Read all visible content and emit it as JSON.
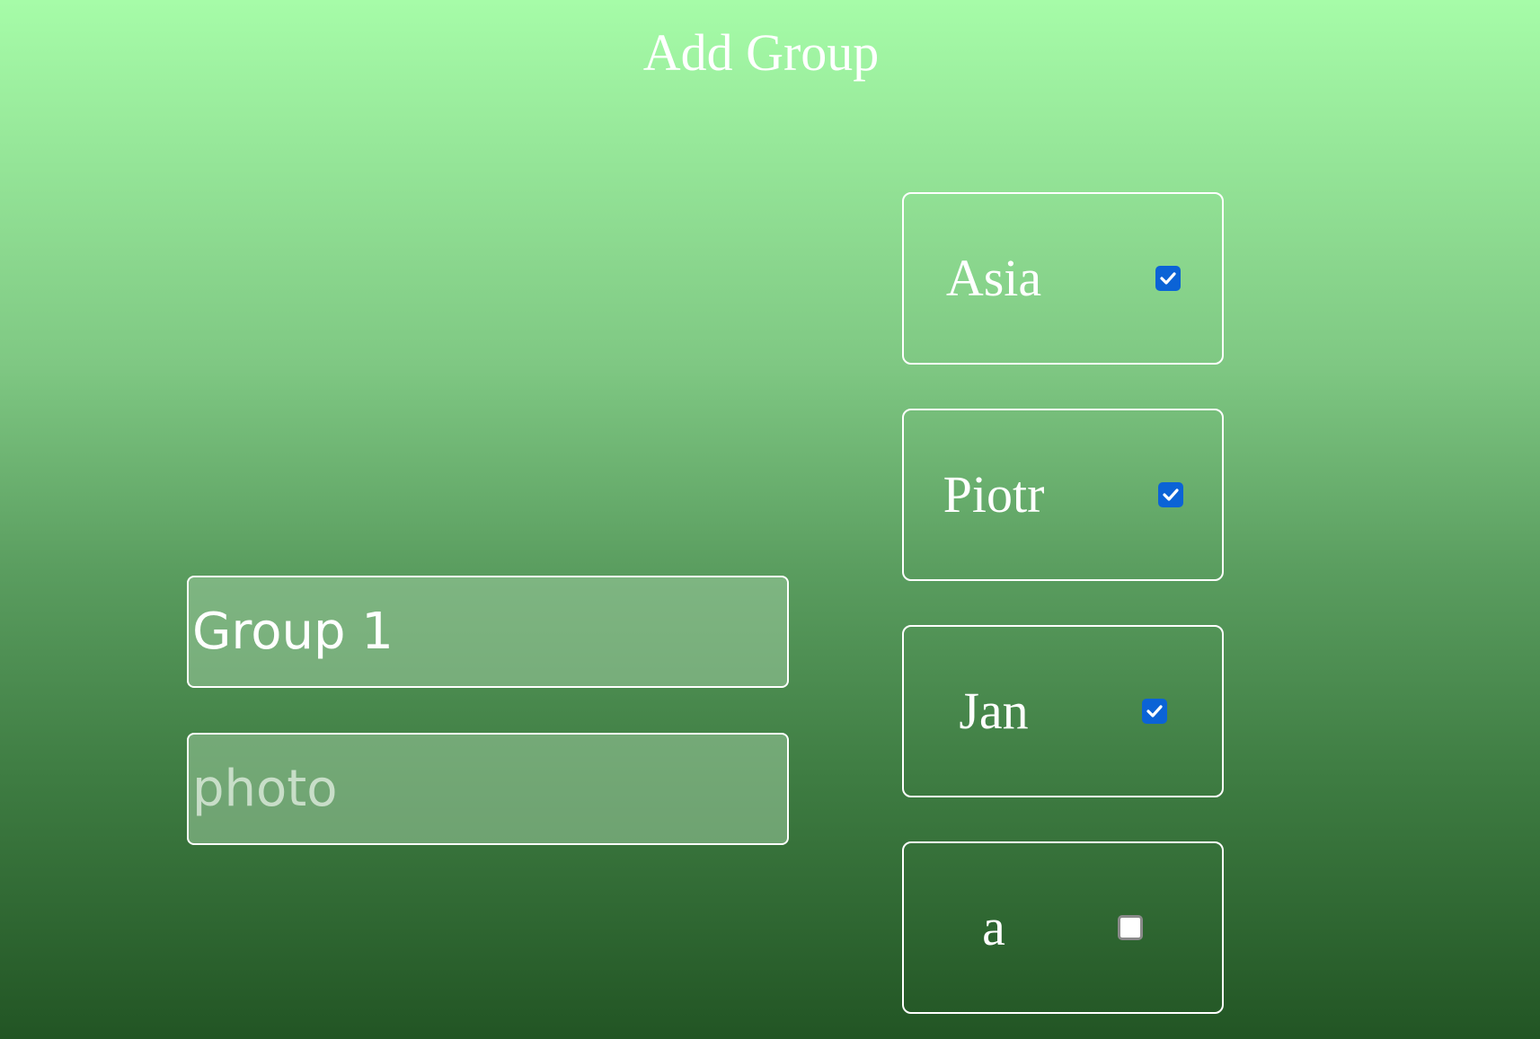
{
  "page": {
    "title": "Add Group"
  },
  "form": {
    "name_value": "Group 1",
    "photo_placeholder": "photo",
    "photo_value": ""
  },
  "members": [
    {
      "name": "Asia",
      "checked": true
    },
    {
      "name": "Piotr",
      "checked": true
    },
    {
      "name": "Jan",
      "checked": true
    },
    {
      "name": "a",
      "checked": false
    }
  ],
  "colors": {
    "gradient_top": "#a6fca8",
    "gradient_bottom": "#225524",
    "checkbox_checked": "#0b63d6",
    "border": "#ffffff"
  }
}
